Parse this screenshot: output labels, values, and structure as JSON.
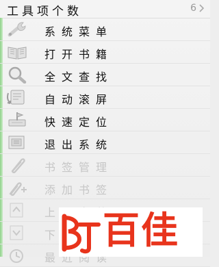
{
  "header": {
    "title": "工具项个数",
    "count": "6"
  },
  "items": [
    {
      "label": "系统菜单",
      "icon": "wrench-icon",
      "enabled": true
    },
    {
      "label": "打开书籍",
      "icon": "open-book-icon",
      "enabled": true
    },
    {
      "label": "全文查找",
      "icon": "magnifier-icon",
      "enabled": true
    },
    {
      "label": "自动滚屏",
      "icon": "auto-scroll-icon",
      "enabled": true
    },
    {
      "label": "快速定位",
      "icon": "locate-icon",
      "enabled": true
    },
    {
      "label": "退出系统",
      "icon": "exit-icon",
      "enabled": true
    },
    {
      "label": "书签管理",
      "icon": "paperclip-icon",
      "enabled": false
    },
    {
      "label": "添加书签",
      "icon": "add-bookmark-icon",
      "enabled": false
    },
    {
      "label": "上一章节",
      "icon": "previous-chapter-icon",
      "enabled": false
    },
    {
      "label": "下一章节",
      "icon": "next-chapter-icon",
      "enabled": false
    },
    {
      "label": "最近阅读",
      "icon": "recent-icon",
      "enabled": false
    }
  ],
  "watermark": {
    "logo_text": "百佳"
  },
  "colors": {
    "accent_green": "#8fd08a",
    "watermark_red": "#e8341c",
    "disabled_text": "#c6c6c6"
  }
}
